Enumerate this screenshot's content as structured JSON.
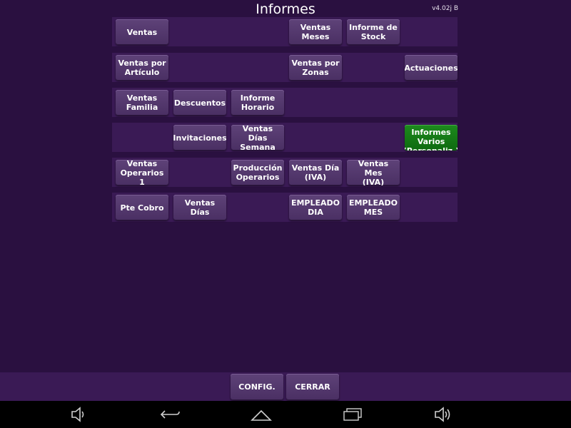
{
  "header": {
    "title": "Informes",
    "version": "v4.02j B"
  },
  "rows": [
    [
      {
        "col": 0,
        "label": "Ventas"
      },
      {
        "col": 3,
        "label": "Ventas\nMeses"
      },
      {
        "col": 4,
        "label": "Informe de\nStock"
      }
    ],
    [
      {
        "col": 0,
        "label": "Ventas por\nArtículo"
      },
      {
        "col": 3,
        "label": "Ventas por\nZonas"
      },
      {
        "col": 5,
        "label": "Actuaciones"
      }
    ],
    [
      {
        "col": 0,
        "label": "Ventas\nFamilia"
      },
      {
        "col": 1,
        "label": "Descuentos"
      },
      {
        "col": 2,
        "label": "Informe\nHorario"
      }
    ],
    [
      {
        "col": 1,
        "label": "Invitaciones"
      },
      {
        "col": 2,
        "label": "Ventas Días\nSemana"
      },
      {
        "col": 5,
        "label": "Informes\nVarios\n(Personaliz.)",
        "highlight": true
      }
    ],
    [
      {
        "col": 0,
        "label": "Ventas\nOperarios 1"
      },
      {
        "col": 2,
        "label": "Producción\nOperarios"
      },
      {
        "col": 3,
        "label": "Ventas Día\n(IVA)"
      },
      {
        "col": 4,
        "label": "Ventas Mes\n(IVA)"
      }
    ],
    [
      {
        "col": 0,
        "label": "Pte Cobro"
      },
      {
        "col": 1,
        "label": "Ventas Días"
      },
      {
        "col": 3,
        "label": "EMPLEADO\nDIA"
      },
      {
        "col": 4,
        "label": "EMPLEADO\nMES"
      }
    ]
  ],
  "footer": {
    "config_label": "CONFIG.",
    "close_label": "CERRAR"
  },
  "navbar": {
    "icons": [
      "volume-down-icon",
      "back-icon",
      "home-icon",
      "recent-apps-icon",
      "volume-up-icon"
    ]
  },
  "colors": {
    "background": "#2a1040",
    "row_band": "#3a1a55",
    "button": "#543872",
    "highlight_button": "#15801a",
    "navbar": "#000000"
  }
}
